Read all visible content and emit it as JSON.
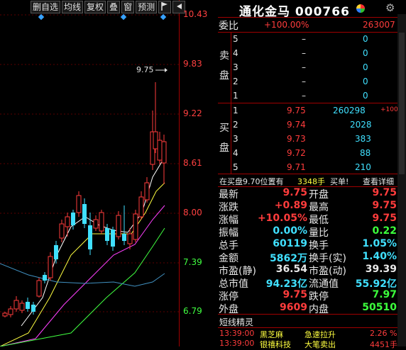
{
  "toolbar": {
    "items": [
      "删自选",
      "均线",
      "复权",
      "叠",
      "窗",
      "预测"
    ],
    "flag_icon": "flag-icon",
    "arrow_icon": "arrow-left-icon"
  },
  "axis": {
    "labels": [
      "10.43",
      "9.83",
      "9.22",
      "8.61",
      "8.00",
      "7.39",
      "6.79"
    ],
    "peak_label": "9.75"
  },
  "colors": {
    "up": "#ff3c3c",
    "down": "#3cff3c",
    "candle_up": "#ff3c3c",
    "candle_down": "#40e0ff",
    "ma5": "#ffffff",
    "ma10": "#ffff40",
    "ma20": "#ff40ff",
    "ma60": "#40ff40",
    "ma120": "#4090c0"
  },
  "header": {
    "name": "通化金马",
    "code": "000766",
    "pie_icon": "pie-chart-icon",
    "settings_icon": "gear-icon"
  },
  "weibi": {
    "label": "委比",
    "value": "+100.00%",
    "amount": "263007"
  },
  "sell": {
    "label_1": "卖",
    "label_2": "盘",
    "rows": [
      {
        "level": "5",
        "price": "–",
        "volume": "0"
      },
      {
        "level": "4",
        "price": "–",
        "volume": "0"
      },
      {
        "level": "3",
        "price": "–",
        "volume": "0"
      },
      {
        "level": "2",
        "price": "–",
        "volume": "0"
      },
      {
        "level": "1",
        "price": "–",
        "volume": "0"
      }
    ]
  },
  "buy": {
    "label_1": "买",
    "label_2": "盘",
    "rows": [
      {
        "level": "1",
        "price": "9.75",
        "volume": "260298",
        "extra": "+100"
      },
      {
        "level": "2",
        "price": "9.74",
        "volume": "2028",
        "extra": ""
      },
      {
        "level": "3",
        "price": "9.73",
        "volume": "383",
        "extra": ""
      },
      {
        "level": "4",
        "price": "9.72",
        "volume": "88",
        "extra": ""
      },
      {
        "level": "5",
        "price": "9.71",
        "volume": "210",
        "extra": ""
      }
    ]
  },
  "notice": {
    "text": "在买盘9.70位置有",
    "volume": "3348手",
    "action": "买单!",
    "detail": "查看详细"
  },
  "stats": [
    {
      "l1": "最新",
      "v1": "9.75",
      "c1": "red",
      "l2": "开盘",
      "v2": "9.75",
      "c2": "red"
    },
    {
      "l1": "涨跌",
      "v1": "+0.89",
      "c1": "red",
      "l2": "最高",
      "v2": "9.75",
      "c2": "red"
    },
    {
      "l1": "涨幅",
      "v1": "+10.05%",
      "c1": "red",
      "l2": "最低",
      "v2": "9.75",
      "c2": "red"
    },
    {
      "l1": "振幅",
      "v1": "0.00%",
      "c1": "cyan",
      "l2": "量比",
      "v2": "0.22",
      "c2": "green"
    },
    {
      "l1": "总手",
      "v1": "60119",
      "c1": "cyan",
      "l2": "换手",
      "v2": "1.05%",
      "c2": "cyan"
    },
    {
      "l1": "金额",
      "v1": "5862万",
      "c1": "cyan",
      "l2": "换手(实)",
      "v2": "1.40%",
      "c2": "cyan"
    },
    {
      "l1": "市盈(静)",
      "v1": "36.54",
      "c1": "white",
      "l2": "市盈(动)",
      "v2": "39.39",
      "c2": "white"
    },
    {
      "l1": "总市值",
      "v1": "94.23亿",
      "c1": "cyan",
      "l2": "流通值",
      "v2": "55.92亿",
      "c2": "cyan"
    },
    {
      "l1": "涨停",
      "v1": "9.75",
      "c1": "red",
      "l2": "跌停",
      "v2": "7.97",
      "c2": "green"
    },
    {
      "l1": "外盘",
      "v1": "9609",
      "c1": "red",
      "l2": "内盘",
      "v2": "50510",
      "c2": "green"
    }
  ],
  "sprite": {
    "title": "短线精灵",
    "rows": [
      {
        "time": "13:39:00",
        "name": "黑芝麻",
        "event": "急速拉升",
        "value": "2.26 %"
      },
      {
        "time": "13:39:00",
        "name": "银禧科技",
        "event": "大笔卖出",
        "value": "4451手"
      }
    ]
  }
}
